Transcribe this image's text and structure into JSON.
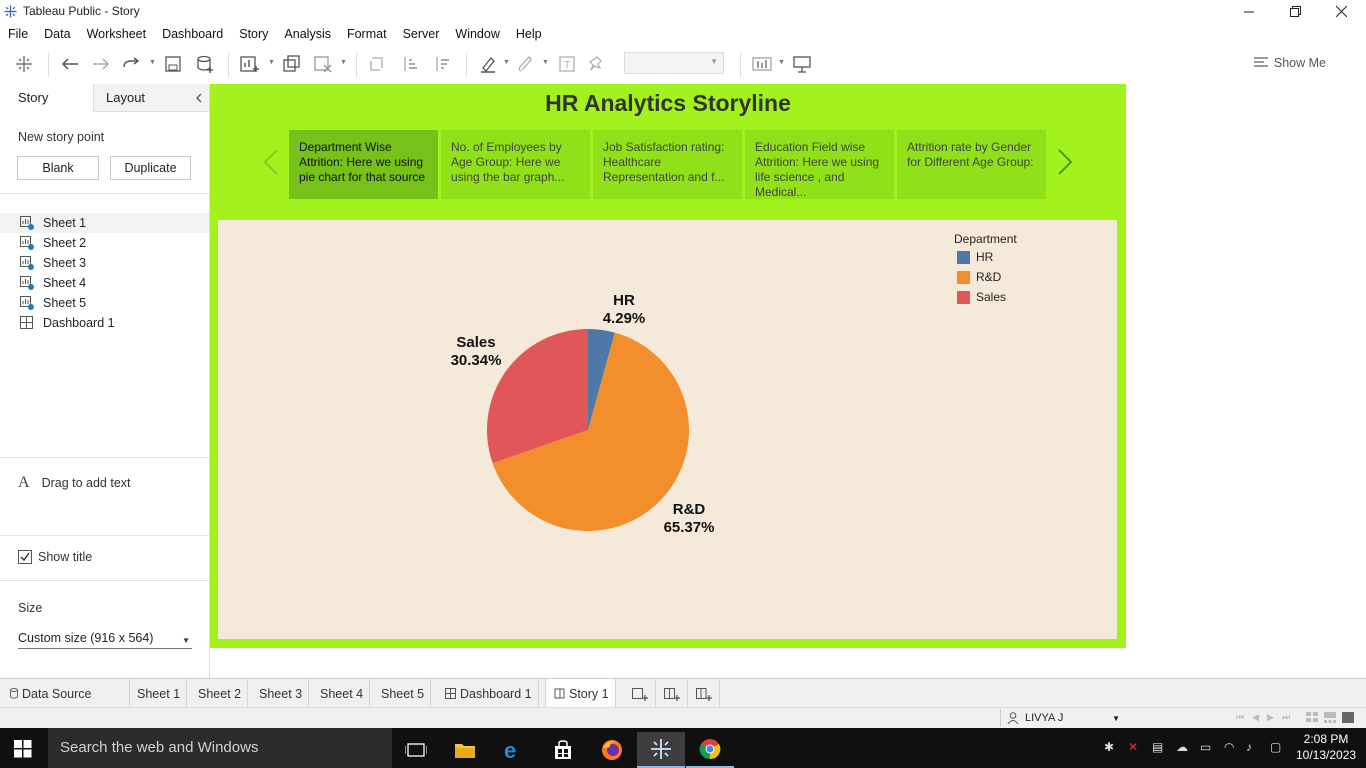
{
  "window": {
    "title": "Tableau Public - Story"
  },
  "menu": [
    "File",
    "Data",
    "Worksheet",
    "Dashboard",
    "Story",
    "Analysis",
    "Format",
    "Server",
    "Window",
    "Help"
  ],
  "toolbar": {
    "show_me_label": "Show Me"
  },
  "left_panel": {
    "tabs": {
      "story": "Story",
      "layout": "Layout"
    },
    "new_story_point_label": "New story point",
    "blank_button": "Blank",
    "duplicate_button": "Duplicate",
    "sheets": [
      "Sheet 1",
      "Sheet 2",
      "Sheet 3",
      "Sheet 4",
      "Sheet 5",
      "Dashboard 1"
    ],
    "drag_text": "Drag to add text",
    "show_title_label": "Show title",
    "size_label": "Size",
    "size_value": "Custom size (916 x 564)"
  },
  "story": {
    "title": "HR Analytics Storyline",
    "points": [
      "Department Wise Attrition: Here we using pie chart for that source",
      "No. of Employees by Age Group: Here we using the bar graph...",
      "Job Satisfaction rating: Healthcare Representation and f...",
      "Education Field wise Attrition: Here we using life science , and Medical...",
      "Attrition rate by Gender for Different Age Group:"
    ]
  },
  "chart_data": {
    "type": "pie",
    "legend_title": "Department",
    "legend_placement": "top-right",
    "categories": [
      "HR",
      "R&D",
      "Sales"
    ],
    "values": [
      4.29,
      65.37,
      30.34
    ],
    "value_labels": [
      "4.29%",
      "65.37%",
      "30.34%"
    ],
    "colors": [
      "#4e79a7",
      "#f28e2b",
      "#e15759"
    ]
  },
  "bottom_tabs": [
    "Data Source",
    "Sheet 1",
    "Sheet 2",
    "Sheet 3",
    "Sheet 4",
    "Sheet 5",
    "Dashboard 1",
    "Story 1"
  ],
  "status": {
    "user": "LIVYA J"
  },
  "taskbar": {
    "search_placeholder": "Search the web and Windows",
    "time": "2:08 PM",
    "date": "10/13/2023"
  }
}
